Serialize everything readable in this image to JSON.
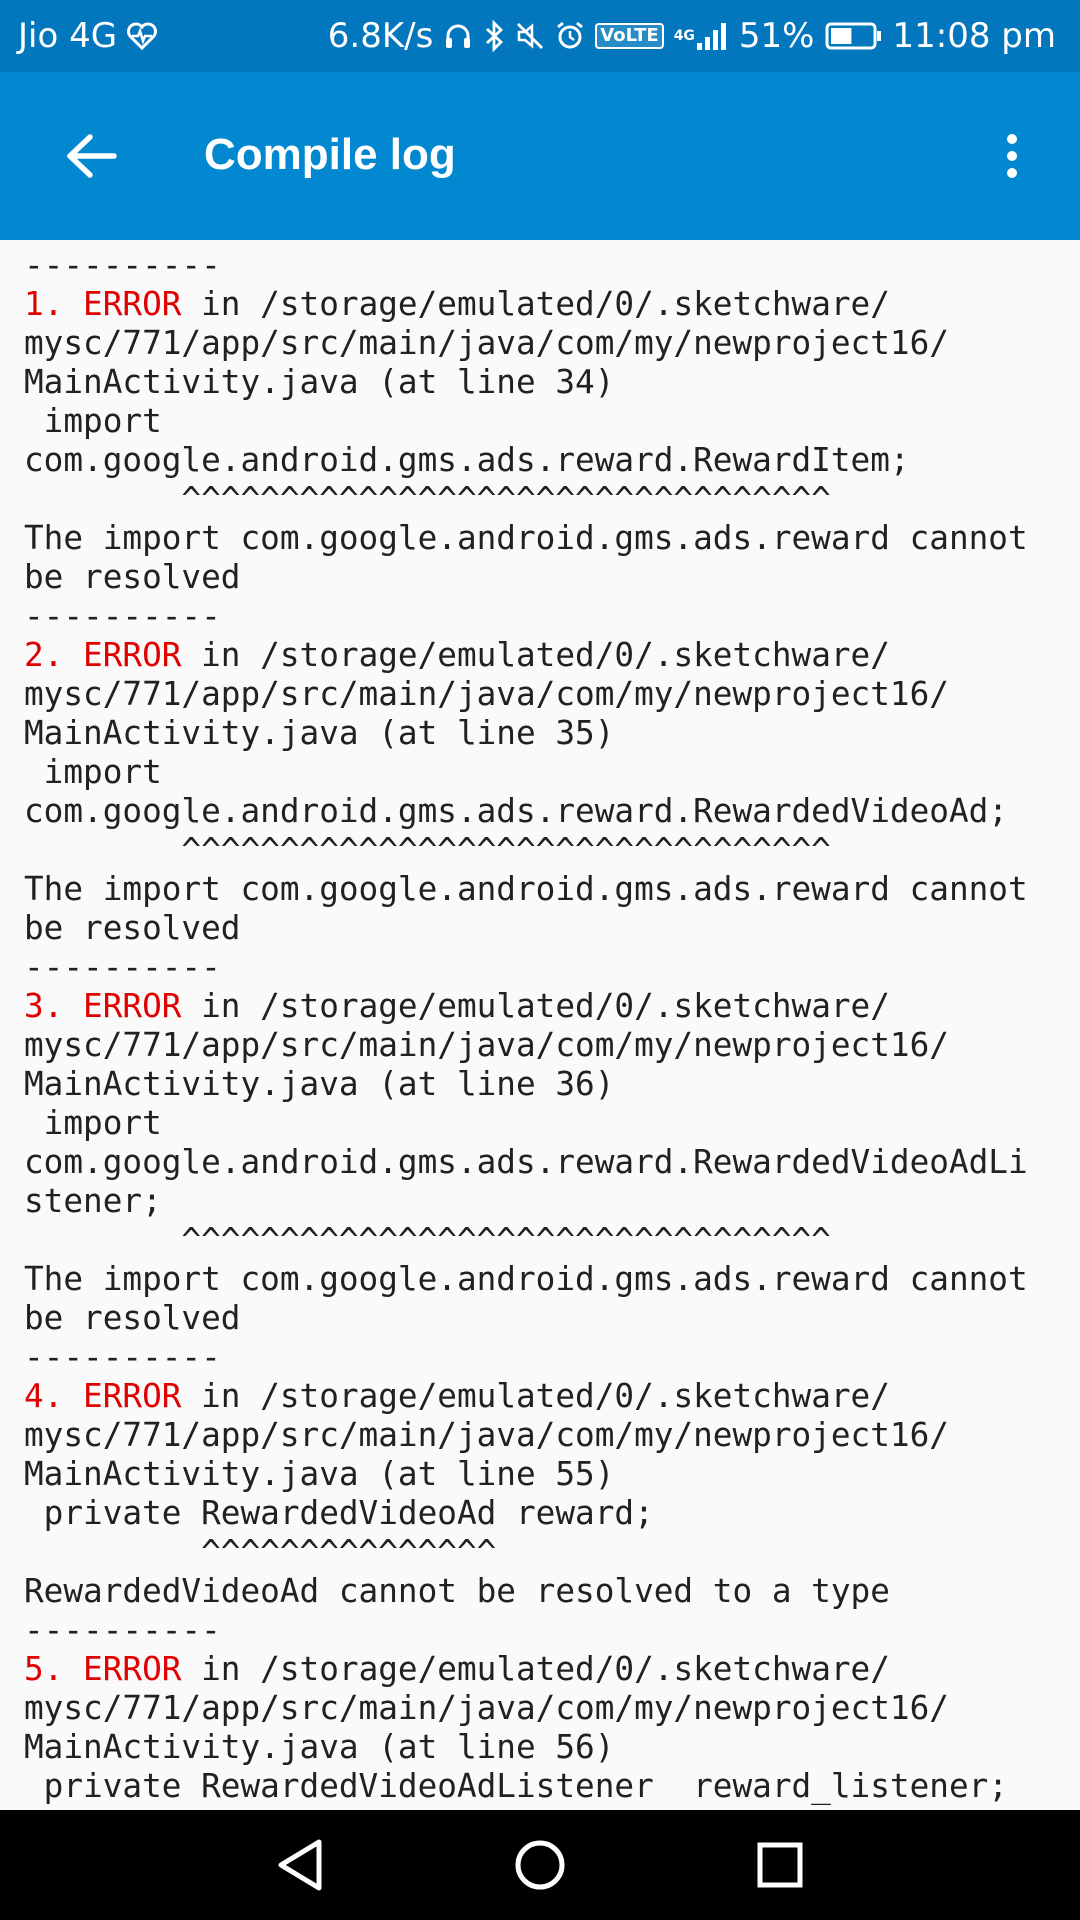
{
  "status_bar": {
    "carrier": "Jio 4G",
    "speed": "6.8K/s",
    "volte": "VoLTE",
    "network": "4G",
    "battery": "51%",
    "battery_level": 0.51,
    "time": "11:08 pm",
    "icons": [
      "heart-monitor-icon",
      "headphones-icon",
      "bluetooth-icon",
      "mute-icon",
      "alarm-icon",
      "volte-icon",
      "signal-icon",
      "battery-icon"
    ]
  },
  "app_bar": {
    "title": "Compile log",
    "back_icon": "arrow-back-icon",
    "menu_icon": "more-vert-icon"
  },
  "log": {
    "lines": [
      {
        "text": "----------"
      },
      {
        "num": "1.",
        "tag": "ERROR",
        "text": " in /storage/emulated/0/.sketchware/"
      },
      {
        "text": "mysc/771/app/src/main/java/com/my/newproject16/"
      },
      {
        "text": "MainActivity.java (at line 34)"
      },
      {
        "text": " import"
      },
      {
        "text": "com.google.android.gms.ads.reward.RewardItem;"
      },
      {
        "text": "        ^^^^^^^^^^^^^^^^^^^^^^^^^^^^^^^^^"
      },
      {
        "text": "The import com.google.android.gms.ads.reward cannot"
      },
      {
        "text": "be resolved"
      },
      {
        "text": "----------"
      },
      {
        "num": "2.",
        "tag": "ERROR",
        "text": " in /storage/emulated/0/.sketchware/"
      },
      {
        "text": "mysc/771/app/src/main/java/com/my/newproject16/"
      },
      {
        "text": "MainActivity.java (at line 35)"
      },
      {
        "text": " import"
      },
      {
        "text": "com.google.android.gms.ads.reward.RewardedVideoAd;"
      },
      {
        "text": "        ^^^^^^^^^^^^^^^^^^^^^^^^^^^^^^^^^"
      },
      {
        "text": "The import com.google.android.gms.ads.reward cannot"
      },
      {
        "text": "be resolved"
      },
      {
        "text": "----------"
      },
      {
        "num": "3.",
        "tag": "ERROR",
        "text": " in /storage/emulated/0/.sketchware/"
      },
      {
        "text": "mysc/771/app/src/main/java/com/my/newproject16/"
      },
      {
        "text": "MainActivity.java (at line 36)"
      },
      {
        "text": " import"
      },
      {
        "text": "com.google.android.gms.ads.reward.RewardedVideoAdLi"
      },
      {
        "text": "stener;"
      },
      {
        "text": "        ^^^^^^^^^^^^^^^^^^^^^^^^^^^^^^^^^"
      },
      {
        "text": "The import com.google.android.gms.ads.reward cannot"
      },
      {
        "text": "be resolved"
      },
      {
        "text": "----------"
      },
      {
        "num": "4.",
        "tag": "ERROR",
        "text": " in /storage/emulated/0/.sketchware/"
      },
      {
        "text": "mysc/771/app/src/main/java/com/my/newproject16/"
      },
      {
        "text": "MainActivity.java (at line 55)"
      },
      {
        "text": " private RewardedVideoAd reward;"
      },
      {
        "text": "         ^^^^^^^^^^^^^^^"
      },
      {
        "text": "RewardedVideoAd cannot be resolved to a type"
      },
      {
        "text": "----------"
      },
      {
        "num": "5.",
        "tag": "ERROR",
        "text": " in /storage/emulated/0/.sketchware/"
      },
      {
        "text": "mysc/771/app/src/main/java/com/my/newproject16/"
      },
      {
        "text": "MainActivity.java (at line 56)"
      },
      {
        "text": " private RewardedVideoAdListener  reward_listener;"
      }
    ]
  },
  "nav_bar": {
    "icons": [
      "back-triangle-icon",
      "home-circle-icon",
      "recents-square-icon"
    ]
  },
  "colors": {
    "status_bar": "#0277bd",
    "app_bar": "#0288d1",
    "error": "#e00000",
    "text": "#212121",
    "background": "#fafafa"
  }
}
